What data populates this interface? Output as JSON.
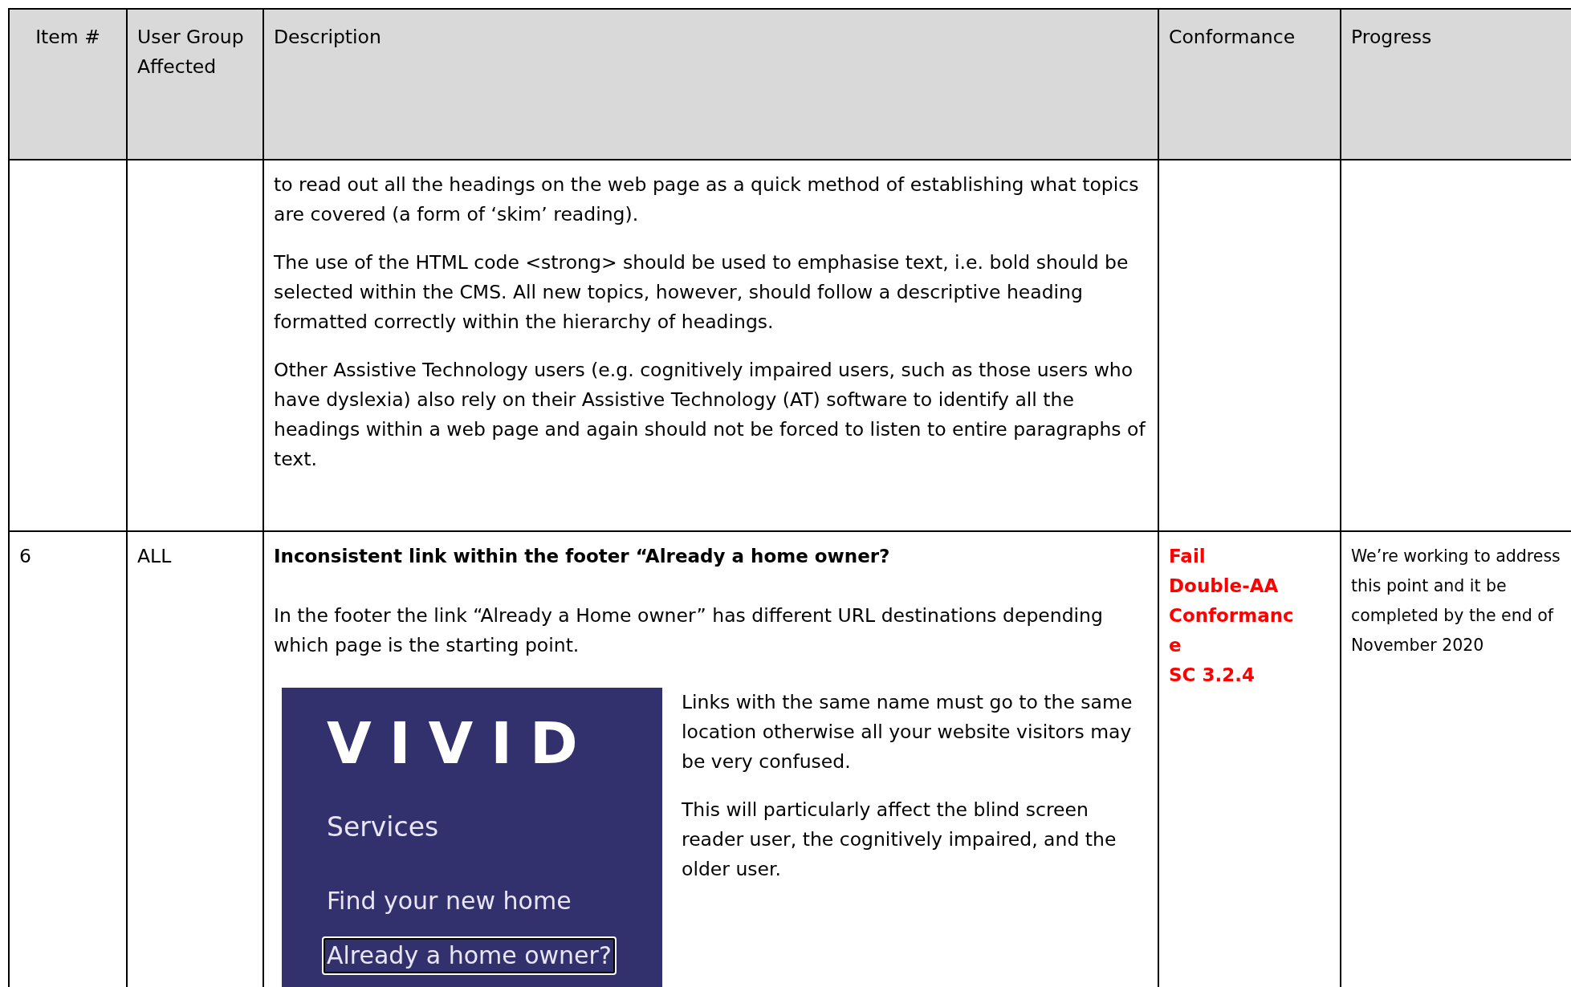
{
  "table": {
    "columns": [
      "Item #",
      "User Group Affected",
      "Description",
      "Conformance",
      "Progress"
    ],
    "rows": [
      {
        "item": "",
        "group": "",
        "description": {
          "paragraphs": [
            "to read out all the headings on the web page as a quick method of establishing what topics are covered (a form of ‘skim’ reading).",
            "The use of the HTML code <strong> should be used to emphasise text, i.e. bold should be selected within the CMS. All new topics, however, should follow a descriptive heading formatted correctly within the hierarchy of headings.",
            "Other Assistive Technology users (e.g. cognitively impaired users, such as those users who have dyslexia) also rely on their Assistive Technology (AT) software to identify all the headings within a web page and again should not be forced to listen to entire paragraphs of text."
          ]
        },
        "conformance": [],
        "progress": ""
      },
      {
        "item": "6",
        "group": "ALL",
        "description": {
          "heading": "Inconsistent link within the footer “Already a home owner?",
          "paragraphs": [
            "In the footer the link “Already a Home owner” has different URL destinations depending which page is the starting point."
          ],
          "figure": {
            "logo": "VIVID",
            "heading": "Services",
            "links": [
              {
                "label": "Find your new home",
                "focused": false
              },
              {
                "label": "Already a home owner?",
                "focused": true
              }
            ]
          },
          "side_paragraphs": [
            "Links with the same name must go to the same location otherwise all your website visitors may be very confused.",
            "This will particularly affect the blind screen reader user, the cognitively impaired, and the older user."
          ]
        },
        "conformance": [
          "Fail",
          "Double-AA",
          "Conformanc",
          "e",
          "SC 3.2.4"
        ],
        "progress": "We’re working to address this point and it be completed by the end of November 2020"
      }
    ]
  }
}
